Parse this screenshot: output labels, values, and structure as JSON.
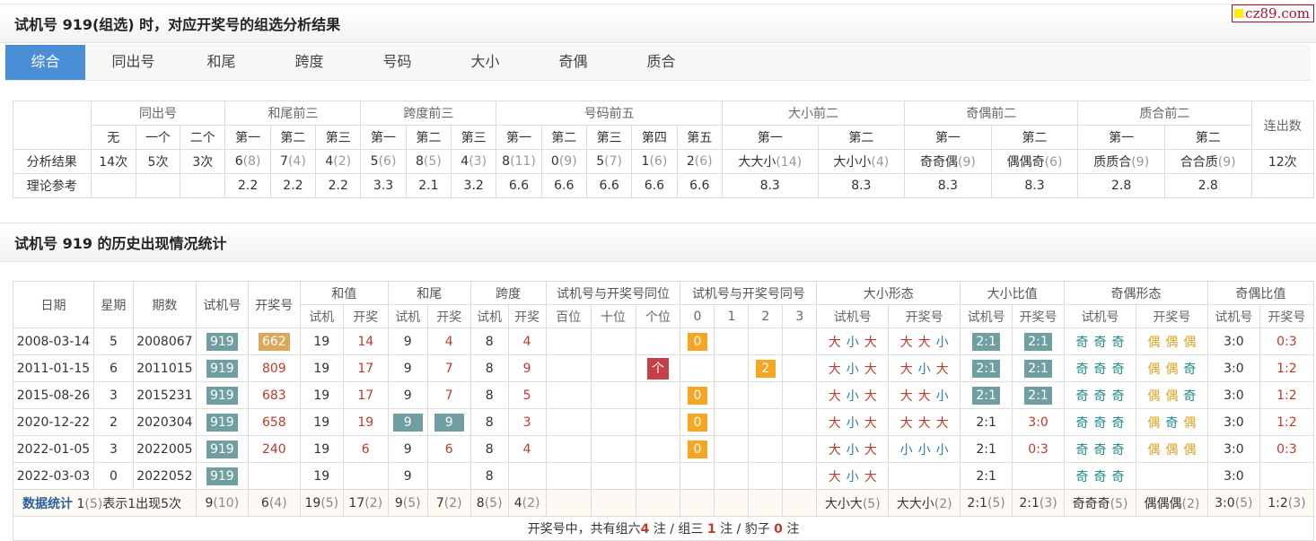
{
  "brand": {
    "label": "cz89.com"
  },
  "section1": {
    "title": "试机号 919(组选) 时，对应开奖号的组选分析结果"
  },
  "tabs": [
    {
      "label": "综合",
      "active": true
    },
    {
      "label": "同出号"
    },
    {
      "label": "和尾"
    },
    {
      "label": "跨度"
    },
    {
      "label": "号码"
    },
    {
      "label": "大小"
    },
    {
      "label": "奇偶"
    },
    {
      "label": "质合"
    }
  ],
  "summary": {
    "groups": [
      "同出号",
      "和尾前三",
      "跨度前三",
      "号码前五",
      "大小前二",
      "奇偶前二",
      "质合前二",
      "连出数"
    ],
    "subheaders": [
      "无",
      "一个",
      "二个",
      "第一",
      "第二",
      "第三",
      "第一",
      "第二",
      "第三",
      "第一",
      "第二",
      "第三",
      "第四",
      "第五",
      "第一",
      "第二",
      "第一",
      "第二",
      "第一",
      "第二"
    ],
    "row_result_label": "分析结果",
    "row_ref_label": "理论参考",
    "results": [
      {
        "v": "14次"
      },
      {
        "v": "5次"
      },
      {
        "v": "3次"
      },
      {
        "v": "6",
        "c": "(8)"
      },
      {
        "v": "7",
        "c": "(4)"
      },
      {
        "v": "4",
        "c": "(2)"
      },
      {
        "v": "5",
        "c": "(6)"
      },
      {
        "v": "8",
        "c": "(5)"
      },
      {
        "v": "4",
        "c": "(3)"
      },
      {
        "v": "8",
        "c": "(11)"
      },
      {
        "v": "0",
        "c": "(9)"
      },
      {
        "v": "5",
        "c": "(7)"
      },
      {
        "v": "1",
        "c": "(6)"
      },
      {
        "v": "2",
        "c": "(6)"
      },
      {
        "v": "大大小",
        "c": "(14)"
      },
      {
        "v": "大小小",
        "c": "(4)"
      },
      {
        "v": "奇奇偶",
        "c": "(9)"
      },
      {
        "v": "偶偶奇",
        "c": "(6)"
      },
      {
        "v": "质质合",
        "c": "(9)"
      },
      {
        "v": "合合质",
        "c": "(9)"
      },
      {
        "v": "12次"
      }
    ],
    "reference": [
      "",
      "",
      "",
      "2.2",
      "2.2",
      "2.2",
      "3.3",
      "2.1",
      "3.2",
      "6.6",
      "6.6",
      "6.6",
      "6.6",
      "6.6",
      "8.3",
      "8.3",
      "8.3",
      "8.3",
      "2.8",
      "2.8",
      ""
    ]
  },
  "section2": {
    "title": "试机号 919 的历史出现情况统计"
  },
  "history": {
    "headers": {
      "date": "日期",
      "weekday": "星期",
      "issue": "期数",
      "trial": "试机号",
      "draw": "开奖号",
      "sum": "和值",
      "sum_tail": "和尾",
      "span": "跨度",
      "same_pos": "试机号与开奖号同位",
      "same_num": "试机号与开奖号同号",
      "bs_shape": "大小形态",
      "bs_ratio": "大小比值",
      "oe_shape": "奇偶形态",
      "oe_ratio": "奇偶比值",
      "sub_trial": "试机",
      "sub_draw": "开奖",
      "pos": [
        "百位",
        "十位",
        "个位"
      ],
      "same": [
        "0",
        "1",
        "2",
        "3"
      ],
      "sub_trial_no": "试机号",
      "sub_draw_no": "开奖号"
    },
    "rows": [
      {
        "date": "2008-03-14",
        "weekday": "5",
        "issue": "2008067",
        "trial": "919",
        "draw": "662",
        "draw_box": "gold",
        "sum_t": "19",
        "sum_d": "14",
        "tail_t": "9",
        "tail_d": "4",
        "span_t": "8",
        "span_d": "4",
        "pos_hit": "",
        "same_idx": "0",
        "bs_t": [
          "大",
          "小",
          "大"
        ],
        "bs_d": [
          "大",
          "大",
          "小"
        ],
        "bsr_t": "2:1",
        "bsr_d": "2:1",
        "bsr_box": true,
        "oe_t": [
          "奇",
          "奇",
          "奇"
        ],
        "oe_d": [
          "偶",
          "偶",
          "偶"
        ],
        "oer_t": "3:0",
        "oer_d": "0:3"
      },
      {
        "date": "2011-01-15",
        "weekday": "6",
        "issue": "2011015",
        "trial": "919",
        "draw": "809",
        "sum_t": "19",
        "sum_d": "17",
        "tail_t": "9",
        "tail_d": "7",
        "span_t": "8",
        "span_d": "9",
        "pos_hit": "个",
        "same_idx": "2",
        "bs_t": [
          "大",
          "小",
          "大"
        ],
        "bs_d": [
          "大",
          "小",
          "大"
        ],
        "bsr_t": "2:1",
        "bsr_d": "2:1",
        "bsr_box": true,
        "oe_t": [
          "奇",
          "奇",
          "奇"
        ],
        "oe_d": [
          "偶",
          "偶",
          "奇"
        ],
        "oer_t": "3:0",
        "oer_d": "1:2"
      },
      {
        "date": "2015-08-26",
        "weekday": "3",
        "issue": "2015231",
        "trial": "919",
        "draw": "683",
        "sum_t": "19",
        "sum_d": "17",
        "tail_t": "9",
        "tail_d": "7",
        "span_t": "8",
        "span_d": "5",
        "pos_hit": "",
        "same_idx": "0",
        "bs_t": [
          "大",
          "小",
          "大"
        ],
        "bs_d": [
          "大",
          "大",
          "小"
        ],
        "bsr_t": "2:1",
        "bsr_d": "2:1",
        "bsr_box": true,
        "oe_t": [
          "奇",
          "奇",
          "奇"
        ],
        "oe_d": [
          "偶",
          "偶",
          "奇"
        ],
        "oer_t": "3:0",
        "oer_d": "1:2"
      },
      {
        "date": "2020-12-22",
        "weekday": "2",
        "issue": "2020304",
        "trial": "919",
        "draw": "658",
        "sum_t": "19",
        "sum_d": "19",
        "tail_t": "9",
        "tail_d": "9",
        "tail_box": true,
        "span_t": "8",
        "span_d": "3",
        "pos_hit": "",
        "same_idx": "0",
        "bs_t": [
          "大",
          "小",
          "大"
        ],
        "bs_d": [
          "大",
          "大",
          "大"
        ],
        "bsr_t": "2:1",
        "bsr_d": "3:0",
        "oe_t": [
          "奇",
          "奇",
          "奇"
        ],
        "oe_d": [
          "偶",
          "奇",
          "偶"
        ],
        "oer_t": "3:0",
        "oer_d": "1:2"
      },
      {
        "date": "2022-01-05",
        "weekday": "3",
        "issue": "2022005",
        "trial": "919",
        "draw": "240",
        "sum_t": "19",
        "sum_d": "6",
        "tail_t": "9",
        "tail_d": "6",
        "span_t": "8",
        "span_d": "4",
        "pos_hit": "",
        "same_idx": "0",
        "bs_t": [
          "大",
          "小",
          "大"
        ],
        "bs_d": [
          "小",
          "小",
          "小"
        ],
        "bsr_t": "2:1",
        "bsr_d": "0:3",
        "oe_t": [
          "奇",
          "奇",
          "奇"
        ],
        "oe_d": [
          "偶",
          "偶",
          "偶"
        ],
        "oer_t": "3:0",
        "oer_d": "0:3"
      },
      {
        "date": "2022-03-03",
        "weekday": "0",
        "issue": "2022052",
        "trial": "919",
        "draw": "",
        "sum_t": "19",
        "sum_d": "",
        "tail_t": "9",
        "tail_d": "",
        "span_t": "8",
        "span_d": "",
        "pos_hit": "",
        "same_idx": "",
        "bs_t": [
          "大",
          "小",
          "大"
        ],
        "bs_d": [],
        "bsr_t": "2:1",
        "bsr_d": "",
        "oe_t": [
          "奇",
          "奇",
          "奇"
        ],
        "oe_d": [],
        "oer_t": "3:0",
        "oer_d": ""
      }
    ],
    "stats": {
      "label": "数据统计",
      "hint_prefix": "1",
      "hint_count": "(5)",
      "hint_text": "表示1出现5次",
      "trial": [
        "9",
        "(10)"
      ],
      "draw": [
        "6",
        "(4)"
      ],
      "sum_t": [
        "19",
        "(5)"
      ],
      "sum_d": [
        "17",
        "(2)"
      ],
      "tail_t": [
        "9",
        "(5)"
      ],
      "tail_d": [
        "7",
        "(2)"
      ],
      "span_t": [
        "8",
        "(5)"
      ],
      "span_d": [
        "4",
        "(2)"
      ],
      "bs_t": [
        "大小大",
        "(5)"
      ],
      "bs_d": [
        "大大小",
        "(2)"
      ],
      "bsr_t": [
        "2:1",
        "(5)"
      ],
      "bsr_d": [
        "2:1",
        "(3)"
      ],
      "oe_t": [
        "奇奇奇",
        "(5)"
      ],
      "oe_d": [
        "偶偶偶",
        "(2)"
      ],
      "oer_t": [
        "3:0",
        "(5)"
      ],
      "oer_d": [
        "1:2",
        "(3)"
      ]
    },
    "footer": {
      "prefix": "开奖号中，共有组六",
      "g6": "4",
      "mid1": "注 / 组三",
      "g3": "1",
      "mid2": "注 / 豹子",
      "bz": "0",
      "suffix": "注"
    }
  },
  "colors": {
    "tab_active": "#4a8fd6",
    "trial_box": "#6f9fa0",
    "gold_box": "#d9a85a",
    "orange_box": "#f5a623",
    "red_box": "#c64047",
    "red_text": "#c0392b",
    "brand": "#b0102a"
  }
}
